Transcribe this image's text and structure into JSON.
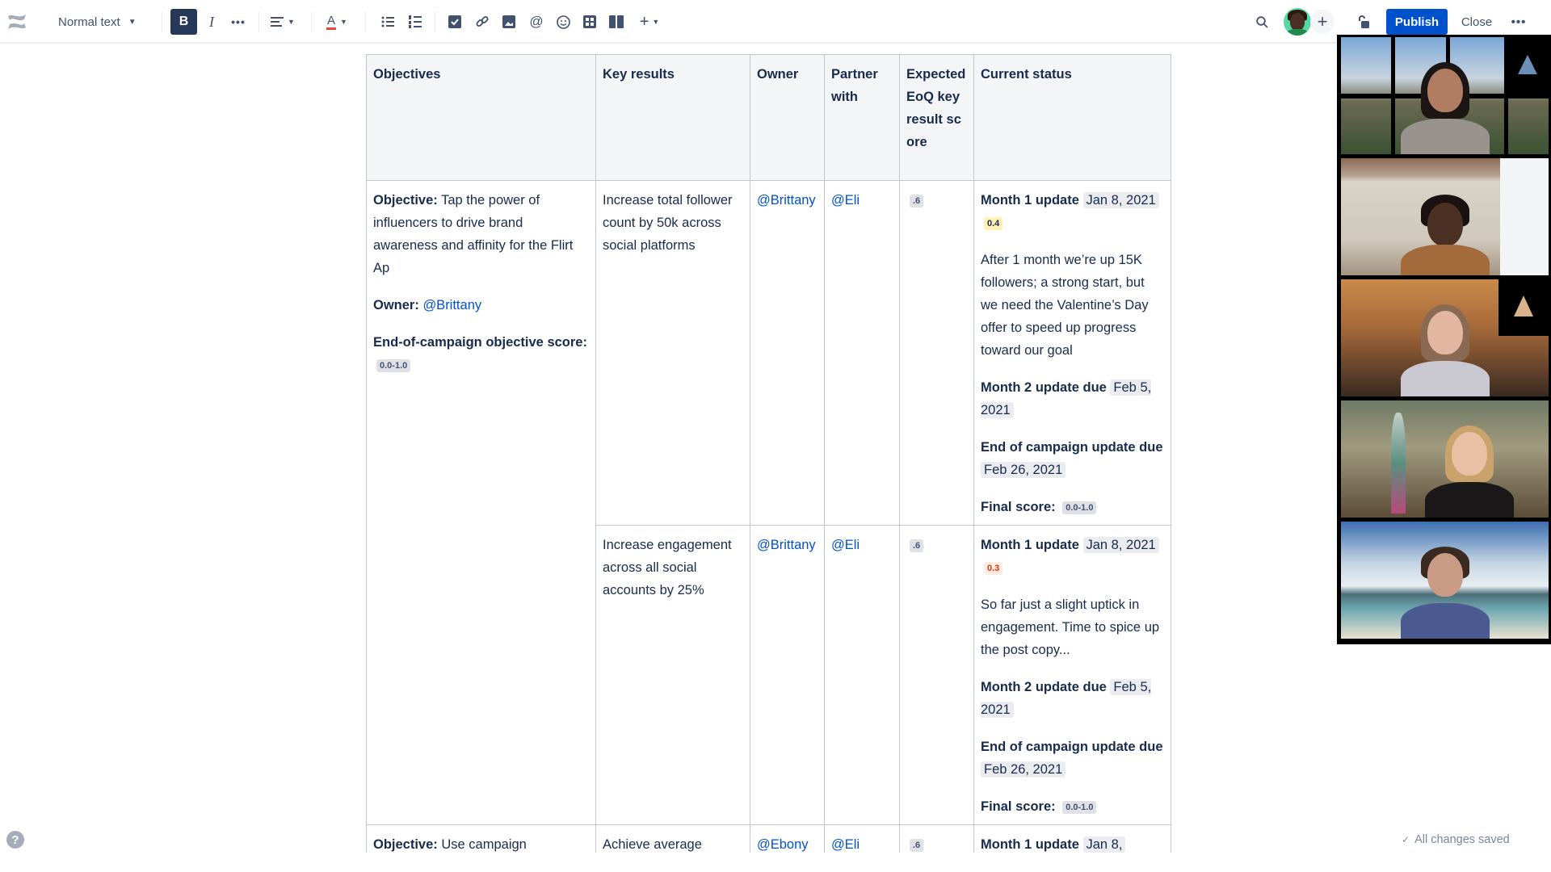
{
  "toolbar": {
    "logo_icon": "confluence-logo-icon",
    "text_style": "Normal text",
    "bold": "B",
    "italic": "I",
    "more_formatting": "•••",
    "align": "≡",
    "text_color": "A",
    "bullet_list": "☰",
    "numbered_list": "☰",
    "insert": "+",
    "publish": "Publish",
    "close": "Close",
    "overflow": "•••"
  },
  "table": {
    "headers": [
      "Objectives",
      "Key results",
      "Owner",
      "Partner with",
      "Expected EoQ key result score",
      "Current status"
    ],
    "objectives": [
      {
        "objective_label": "Objective:",
        "objective_text": " Tap the power of influencers to drive brand awareness and affinity for the Flirt Ap",
        "owner_label": "Owner:",
        "owner": "@Brittany",
        "score_label": "End-of-campaign objective score:",
        "score_range": "0.0-1.0"
      },
      {
        "objective_label": "Objective:",
        "objective_text": " Use campaign"
      }
    ],
    "key_results": [
      {
        "text": "Increase total follower count by 50k across social platforms",
        "owner": "@Brittany",
        "partner": "@Eli",
        "expected_score": ".6",
        "status": {
          "m1_label": "Month 1 update",
          "m1_date": "Jan 8, 2021",
          "m1_score": "0.4",
          "m1_note": "After 1 month we’re up 15K followers; a strong start, but we need the Valentine’s Day offer to speed up progress toward our goal",
          "m2_label": "Month 2 update due",
          "m2_date": "Feb 5, 2021",
          "end_label": "End of campaign update due",
          "end_date": "Feb 26, 2021",
          "final_label": "Final score:",
          "final_range": "0.0-1.0"
        }
      },
      {
        "text": "Increase engagement across all social accounts by 25%",
        "owner": "@Brittany",
        "partner": "@Eli",
        "expected_score": ".6",
        "status": {
          "m1_label": "Month 1 update",
          "m1_date": "Jan 8, 2021",
          "m1_score": "0.3",
          "m1_note": "So far just a slight uptick in engagement. Time to spice up the post copy...",
          "m2_label": "Month 2 update due",
          "m2_date": "Feb 5, 2021",
          "end_label": "End of campaign update due",
          "end_date": "Feb 26, 2021",
          "final_label": "Final score:",
          "final_range": "0.0-1.0"
        }
      },
      {
        "text": "Achieve average",
        "owner": "@Ebony",
        "partner": "@Eli",
        "expected_score": ".6",
        "status": {
          "m1_label": "Month 1 update",
          "m1_date": "Jan 8,"
        }
      }
    ]
  },
  "video_call": {
    "participants": 5
  },
  "footer": {
    "help": "?",
    "save_status": "All changes saved",
    "check": "✓"
  },
  "colors": {
    "primary": "#0052cc",
    "text": "#172b4d",
    "score_yellow_bg": "#fff0b3",
    "score_red": "#de350b"
  }
}
